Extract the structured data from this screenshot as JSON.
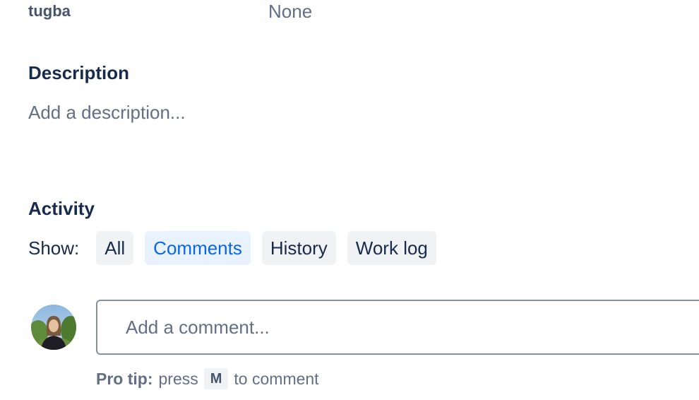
{
  "field": {
    "label": "tugba",
    "value": "None"
  },
  "description": {
    "heading": "Description",
    "placeholder": "Add a description..."
  },
  "activity": {
    "heading": "Activity",
    "show_label": "Show:",
    "filters": [
      {
        "label": "All",
        "active": false
      },
      {
        "label": "Comments",
        "active": true
      },
      {
        "label": "History",
        "active": false
      },
      {
        "label": "Work log",
        "active": false
      }
    ]
  },
  "comment": {
    "placeholder": "Add a comment...",
    "pro_tip_label": "Pro tip:",
    "pro_tip_before": "press",
    "pro_tip_key": "M",
    "pro_tip_after": "to comment"
  },
  "colors": {
    "accent": "#0C66E4",
    "active_bg": "#E9F2FF",
    "button_bg": "#F1F2F4",
    "text_primary": "#172B4D",
    "text_subtle": "#626F86"
  },
  "icons": {
    "avatar": "user-avatar-photo"
  }
}
